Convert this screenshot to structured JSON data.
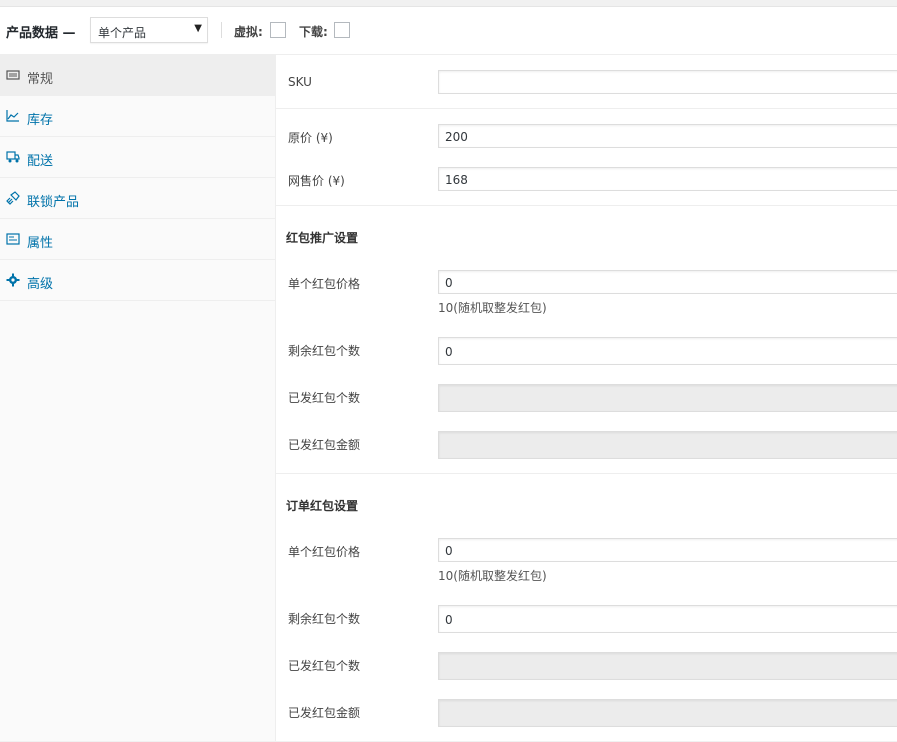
{
  "header": {
    "title": "产品数据 —",
    "product_type": "单个产品",
    "virtual_label": "虚拟:",
    "download_label": "下载:"
  },
  "sidebar": {
    "items": [
      {
        "label": "常规",
        "icon": "list-icon",
        "active": true
      },
      {
        "label": "库存",
        "icon": "chart-icon",
        "active": false
      },
      {
        "label": "配送",
        "icon": "truck-icon",
        "active": false
      },
      {
        "label": "联锁产品",
        "icon": "link-icon",
        "active": false
      },
      {
        "label": "属性",
        "icon": "attributes-icon",
        "active": false
      },
      {
        "label": "高级",
        "icon": "gear-icon",
        "active": false
      }
    ]
  },
  "general": {
    "sku_label": "SKU",
    "sku_value": "",
    "regular_price_label": "原价 (¥)",
    "regular_price_value": "200",
    "sale_price_label": "网售价 (¥)",
    "sale_price_value": "168"
  },
  "promo_redpacket": {
    "section_title": "红包推广设置",
    "price_label": "单个红包价格",
    "price_value": "0",
    "price_desc": "10(随机取整发红包)",
    "remaining_label": "剩余红包个数",
    "remaining_value": "0",
    "sent_count_label": "已发红包个数",
    "sent_amount_label": "已发红包金额"
  },
  "order_redpacket": {
    "section_title": "订单红包设置",
    "price_label": "单个红包价格",
    "price_value": "0",
    "price_desc": "10(随机取整发红包)",
    "remaining_label": "剩余红包个数",
    "remaining_value": "0",
    "sent_count_label": "已发红包个数",
    "sent_amount_label": "已发红包金额"
  },
  "colors": {
    "link": "#0073aa",
    "active_tab_bg": "#eeeeee",
    "disabled_input_bg": "#ececec"
  }
}
